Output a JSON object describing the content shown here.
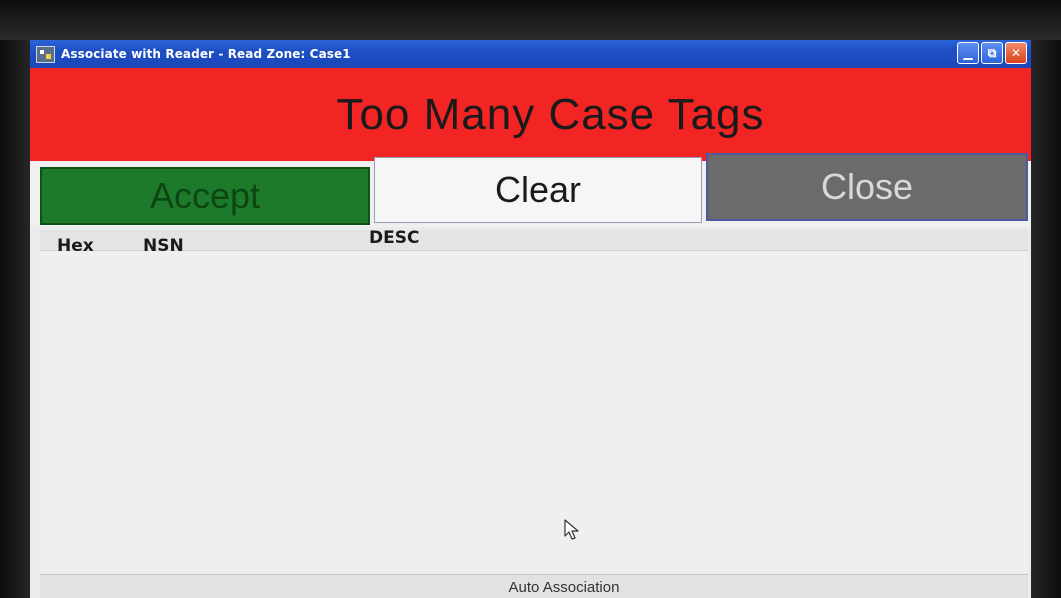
{
  "window": {
    "title": "Associate with Reader - Read Zone: Case1",
    "controls": {
      "minimize_icon": "minimize-icon",
      "restore_icon": "restore-icon",
      "close_icon": "close-icon"
    }
  },
  "banner": {
    "message": "Too Many Case Tags",
    "color": "#f22424"
  },
  "buttons": {
    "accept_label": "Accept",
    "clear_label": "Clear",
    "close_label": "Close"
  },
  "table": {
    "columns": [
      "Hex",
      "NSN",
      "DESC"
    ],
    "rows": []
  },
  "status": {
    "text": "Auto Association"
  }
}
